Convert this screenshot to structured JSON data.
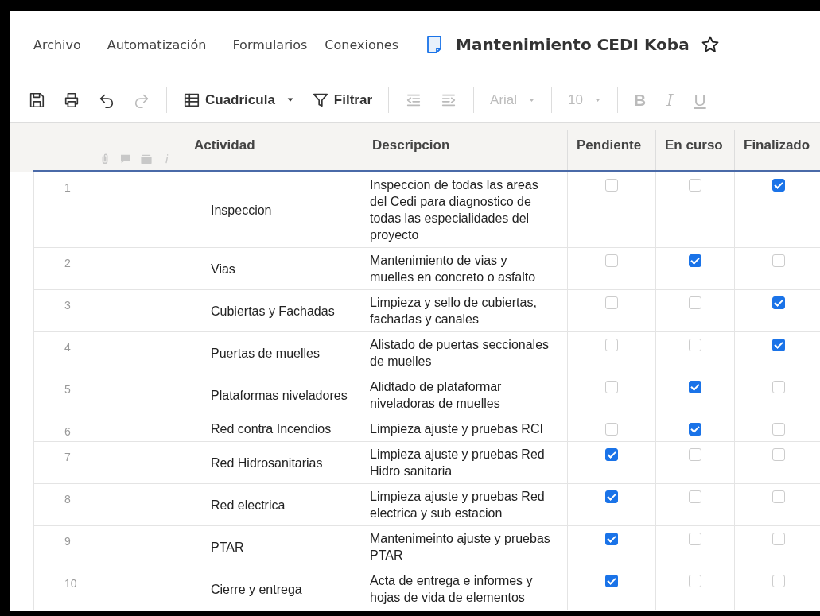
{
  "menu": [
    {
      "label": "Archivo"
    },
    {
      "label": "Automatización"
    },
    {
      "label": "Formularios"
    },
    {
      "label": "Conexiones"
    }
  ],
  "document": {
    "title": "Mantenimiento CEDI Koba",
    "starred": false
  },
  "toolbar": [
    {
      "kind": "save",
      "disabled": false
    },
    {
      "kind": "print",
      "disabled": false
    },
    {
      "kind": "undo",
      "disabled": false
    },
    {
      "kind": "redo",
      "disabled": true
    },
    {
      "kind": "separator"
    },
    {
      "kind": "view",
      "label": "Cuadrícula",
      "disabled": false
    },
    {
      "kind": "filter",
      "label": "Filtrar",
      "disabled": false
    },
    {
      "kind": "separator"
    },
    {
      "kind": "outdent",
      "disabled": true
    },
    {
      "kind": "indent",
      "disabled": true
    },
    {
      "kind": "separator"
    },
    {
      "kind": "font",
      "label": "Arial",
      "disabled": true
    },
    {
      "kind": "separator"
    },
    {
      "kind": "size",
      "label": "10",
      "disabled": true
    },
    {
      "kind": "separator"
    },
    {
      "kind": "bold",
      "label": "B",
      "disabled": true
    },
    {
      "kind": "italic",
      "label": "I",
      "disabled": true
    },
    {
      "kind": "underline",
      "label": "U",
      "disabled": true
    }
  ],
  "table": {
    "columns": [
      "Actividad",
      "Descripcion",
      "Pendiente",
      "En curso",
      "Finalizado"
    ],
    "rows": [
      {
        "number": "1",
        "actividad": "Inspeccion",
        "descripcion": "Inspeccion de todas las areas del Cedi para diagnostico de todas las especialidades del proyecto",
        "pendiente": false,
        "en_curso": false,
        "finalizado": true
      },
      {
        "number": "2",
        "actividad": "Vias",
        "descripcion": "Mantenimiento de vias y muelles en concreto o asfalto",
        "pendiente": false,
        "en_curso": true,
        "finalizado": false
      },
      {
        "number": "3",
        "actividad": "Cubiertas y Fachadas",
        "descripcion": "Limpieza y sello de cubiertas, fachadas y canales",
        "pendiente": false,
        "en_curso": false,
        "finalizado": true
      },
      {
        "number": "4",
        "actividad": "Puertas de muelles",
        "descripcion": "Alistado de puertas seccionales de muelles",
        "pendiente": false,
        "en_curso": false,
        "finalizado": true
      },
      {
        "number": "5",
        "actividad": "Plataformas niveladores",
        "descripcion": "Alidtado de plataformar niveladoras de muelles",
        "pendiente": false,
        "en_curso": true,
        "finalizado": false
      },
      {
        "number": "6",
        "actividad": "Red contra Incendios",
        "descripcion": "Limpieza ajuste y pruebas RCI",
        "pendiente": false,
        "en_curso": true,
        "finalizado": false
      },
      {
        "number": "7",
        "actividad": "Red Hidrosanitarias",
        "descripcion": "Limpieza ajuste y pruebas Red Hidro sanitaria",
        "pendiente": true,
        "en_curso": false,
        "finalizado": false
      },
      {
        "number": "8",
        "actividad": "Red electrica",
        "descripcion": "Limpieza ajuste y pruebas Red electrica y sub estacion",
        "pendiente": true,
        "en_curso": false,
        "finalizado": false
      },
      {
        "number": "9",
        "actividad": "PTAR",
        "descripcion": "Mantenimeinto ajuste y pruebas PTAR",
        "pendiente": true,
        "en_curso": false,
        "finalizado": false
      },
      {
        "number": "10",
        "actividad": "Cierre y entrega",
        "descripcion": "Acta de entrega e informes y hojas de vida de elementos",
        "pendiente": true,
        "en_curso": false,
        "finalizado": false
      }
    ]
  }
}
